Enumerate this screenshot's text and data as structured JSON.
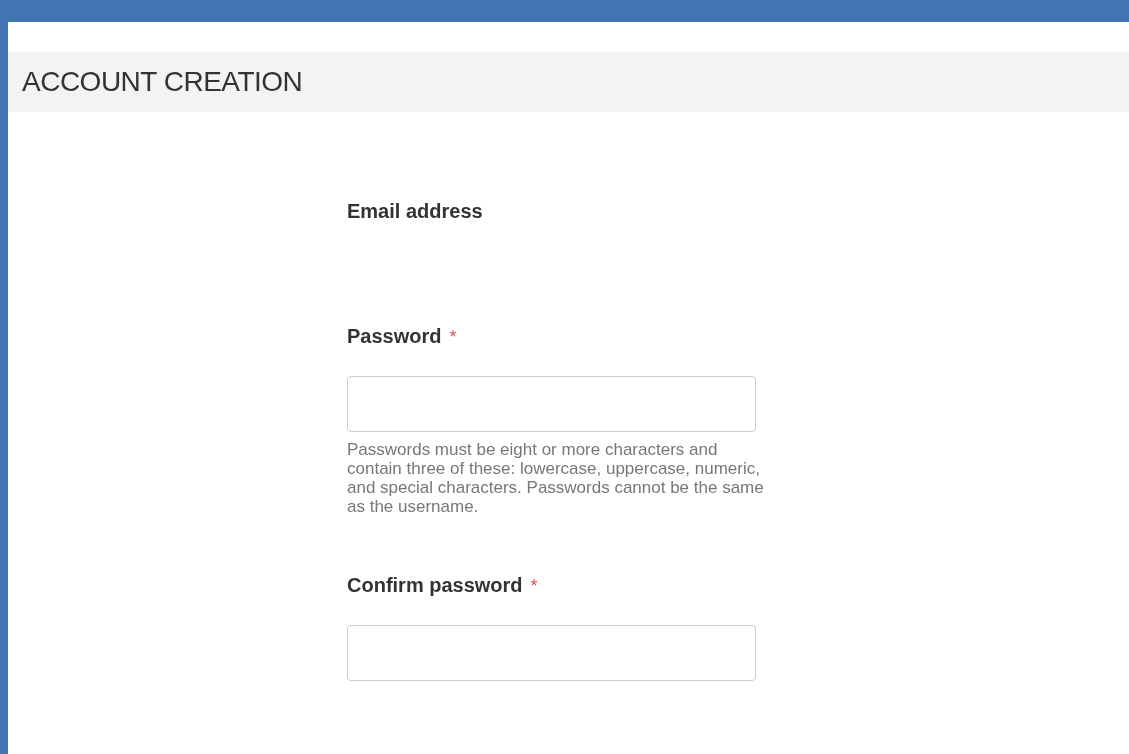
{
  "header": {
    "title": "ACCOUNT CREATION"
  },
  "fields": [
    {
      "kind": "label",
      "label": "Email address"
    },
    {
      "kind": "password",
      "label": "Password",
      "required_mark": "*",
      "help": "Passwords must be eight or more characters and contain three of these: lowercase, uppercase, numeric, and special characters. Passwords cannot be the same as the username."
    },
    {
      "kind": "password",
      "label": "Confirm password",
      "required_mark": "*"
    }
  ]
}
